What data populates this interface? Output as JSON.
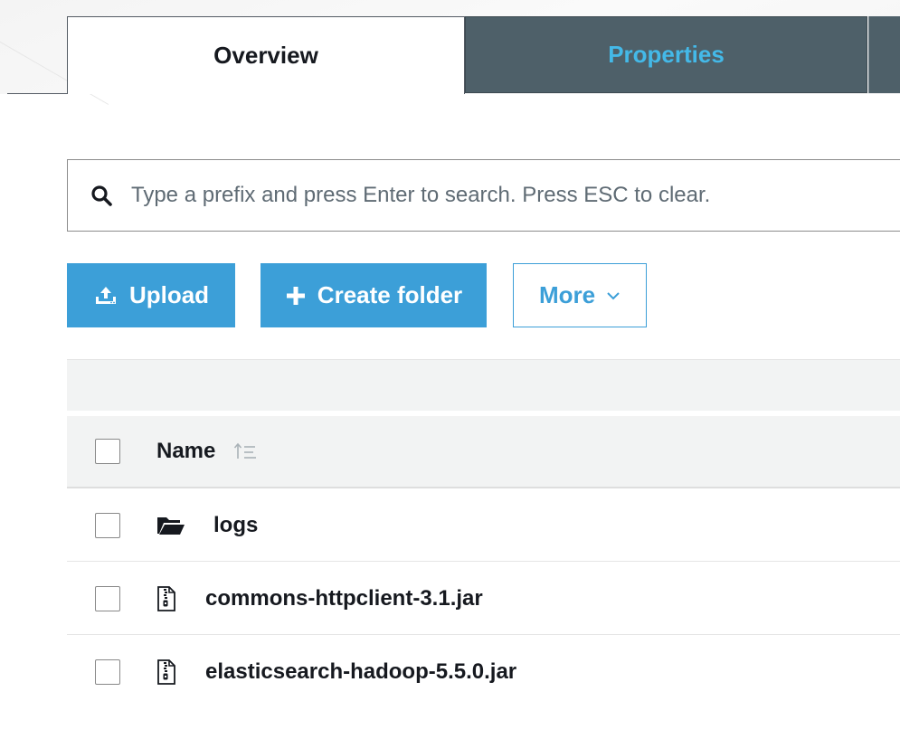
{
  "tabs": [
    {
      "label": "Overview",
      "active": true
    },
    {
      "label": "Properties",
      "active": false
    }
  ],
  "search": {
    "placeholder": "Type a prefix and press Enter to search. Press ESC to clear.",
    "value": ""
  },
  "actions": {
    "upload_label": "Upload",
    "create_folder_label": "Create folder",
    "more_label": "More"
  },
  "table": {
    "columns": [
      {
        "label": "Name",
        "sort": "ascending"
      }
    ],
    "rows": [
      {
        "name": "logs",
        "type": "folder",
        "icon": "folder-icon"
      },
      {
        "name": "commons-httpclient-3.1.jar",
        "type": "file",
        "icon": "zip-file-icon"
      },
      {
        "name": "elasticsearch-hadoop-5.5.0.jar",
        "type": "file",
        "icon": "zip-file-icon"
      }
    ]
  },
  "colors": {
    "primary_button": "#3c9fd8",
    "tab_dark": "#4e6069",
    "tab_active_text": "#16191f",
    "tab_inactive_text": "#44b9e8"
  }
}
